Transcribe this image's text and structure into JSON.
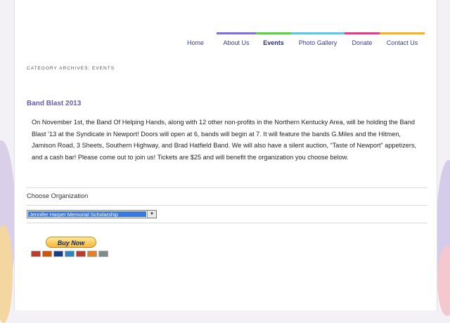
{
  "nav": {
    "items": [
      {
        "label": "Home",
        "color": "#ffffff",
        "active": false
      },
      {
        "label": "About Us",
        "color": "#7b6fe0",
        "active": false
      },
      {
        "label": "Events",
        "color": "#55d23c",
        "active": true
      },
      {
        "label": "Photo Gallery",
        "color": "#56c8e8",
        "active": false
      },
      {
        "label": "Donate",
        "color": "#e33b86",
        "active": false
      },
      {
        "label": "Contact Us",
        "color": "#f5b21e",
        "active": false
      }
    ]
  },
  "category_heading": "CATEGORY ARCHIVES: EVENTS",
  "post": {
    "title": "Band Blast 2013",
    "body": "On November 1st, the Band Of Helping Hands, along with 12 other non-profits in the Northern Kentucky Area, will be holding the Band Blast ’13 at the Syndicate in Newport! Doors will open at 6, bands will begin at 7. It will feature the bands G.Miles and the Hitmen, Jamison Road, 3 Sheets, Southern Highway, and Brad Hatfield Band. We will also have a silent auction, “Taste of Newport” appetizers, and a cash bar! Please come out to join us! Tickets are $25 and will benefit the organization you choose below."
  },
  "form": {
    "choose_label": "Choose Organization",
    "selected_option": "Jennifer Harper Memorial Scholarship",
    "buy_button": "Buy Now",
    "payment_icons": [
      "mastercard-icon",
      "maestro-icon",
      "visa-icon",
      "amex-icon",
      "mastercard-icon",
      "discover-icon",
      "bank-icon"
    ]
  }
}
